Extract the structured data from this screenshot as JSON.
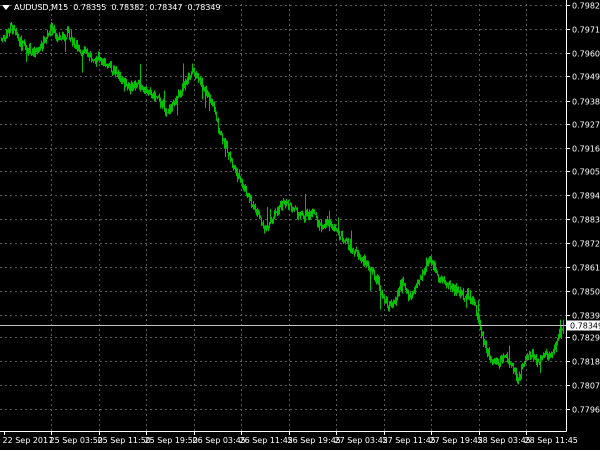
{
  "header": {
    "symbol": "AUDUSD,M15",
    "open": "0.78355",
    "high": "0.78382",
    "low": "0.78347",
    "close": "0.78349"
  },
  "colors": {
    "background": "#000000",
    "grid": "#5a5a5a",
    "axis": "#ffffff",
    "candle": "#00c000",
    "bid_line": "#c0c0c0",
    "price_tag_bg": "#ffffff",
    "price_tag_text": "#000000"
  },
  "icons": {
    "menu": "triangle-down-icon"
  },
  "current_price": {
    "value": 0.78349,
    "label": "0.78349"
  },
  "chart_data": {
    "type": "candlestick",
    "symbol": "AUDUSD",
    "timeframe": "M15",
    "ylim": [
      0.7776,
      0.7982
    ],
    "y_ticks": [
      "0.79820",
      "0.79710",
      "0.79600",
      "0.79495",
      "0.79380",
      "0.79270",
      "0.79160",
      "0.79055",
      "0.78945",
      "0.78835",
      "0.78725",
      "0.78615",
      "0.78505",
      "0.78395",
      "0.78290",
      "0.78180",
      "0.78070",
      "0.77960"
    ],
    "x_ticks": [
      "22 Sep 2017",
      "25 Sep 03:50",
      "25 Sep 11:50",
      "25 Sep 19:50",
      "26 Sep 03:45",
      "26 Sep 11:45",
      "26 Sep 19:45",
      "27 Sep 03:45",
      "27 Sep 11:45",
      "27 Sep 19:45",
      "28 Sep 03:45",
      "28 Sep 11:45"
    ],
    "grid": true,
    "anchors": [
      [
        0,
        0.7966
      ],
      [
        1.5,
        0.7972
      ],
      [
        3,
        0.7964
      ],
      [
        4,
        0.7962
      ],
      [
        5,
        0.7959
      ],
      [
        6.5,
        0.7966
      ],
      [
        7.5,
        0.7972
      ],
      [
        8.5,
        0.7966
      ],
      [
        10,
        0.7969
      ],
      [
        11,
        0.7964
      ],
      [
        12,
        0.7961
      ],
      [
        14,
        0.7958
      ],
      [
        15.5,
        0.7956
      ],
      [
        16.5,
        0.7953
      ],
      [
        18,
        0.7948
      ],
      [
        19.5,
        0.7944
      ],
      [
        20.5,
        0.7946
      ],
      [
        22,
        0.7942
      ],
      [
        23.5,
        0.7939
      ],
      [
        25,
        0.7933
      ],
      [
        26,
        0.7936
      ],
      [
        27.5,
        0.7945
      ],
      [
        29,
        0.7951
      ],
      [
        30,
        0.7947
      ],
      [
        31.5,
        0.7939
      ],
      [
        33,
        0.7924
      ],
      [
        35,
        0.7908
      ],
      [
        37,
        0.7895
      ],
      [
        39,
        0.7884
      ],
      [
        40,
        0.7878
      ],
      [
        41,
        0.7885
      ],
      [
        42.5,
        0.7891
      ],
      [
        44,
        0.7888
      ],
      [
        45.5,
        0.7884
      ],
      [
        47,
        0.7887
      ],
      [
        48,
        0.788
      ],
      [
        49.5,
        0.7882
      ],
      [
        51,
        0.7876
      ],
      [
        52,
        0.7873
      ],
      [
        53.5,
        0.7868
      ],
      [
        55,
        0.7863
      ],
      [
        56.5,
        0.7857
      ],
      [
        57.5,
        0.7849
      ],
      [
        58.5,
        0.7843
      ],
      [
        59.5,
        0.7846
      ],
      [
        60.5,
        0.7855
      ],
      [
        61.5,
        0.7847
      ],
      [
        62.5,
        0.7851
      ],
      [
        63.5,
        0.7858
      ],
      [
        64.5,
        0.7866
      ],
      [
        65.5,
        0.786
      ],
      [
        66.5,
        0.7855
      ],
      [
        68,
        0.7852
      ],
      [
        69.5,
        0.7849
      ],
      [
        70.5,
        0.7848
      ],
      [
        71.5,
        0.7843
      ],
      [
        72.5,
        0.783
      ],
      [
        73.5,
        0.7821
      ],
      [
        75,
        0.7817
      ],
      [
        76,
        0.782
      ],
      [
        77,
        0.7816
      ],
      [
        78,
        0.7809
      ],
      [
        79,
        0.7819
      ],
      [
        80,
        0.7821
      ],
      [
        81,
        0.7817
      ],
      [
        82,
        0.7822
      ],
      [
        83,
        0.782
      ],
      [
        84,
        0.7829
      ],
      [
        84.8,
        0.7835
      ]
    ]
  }
}
